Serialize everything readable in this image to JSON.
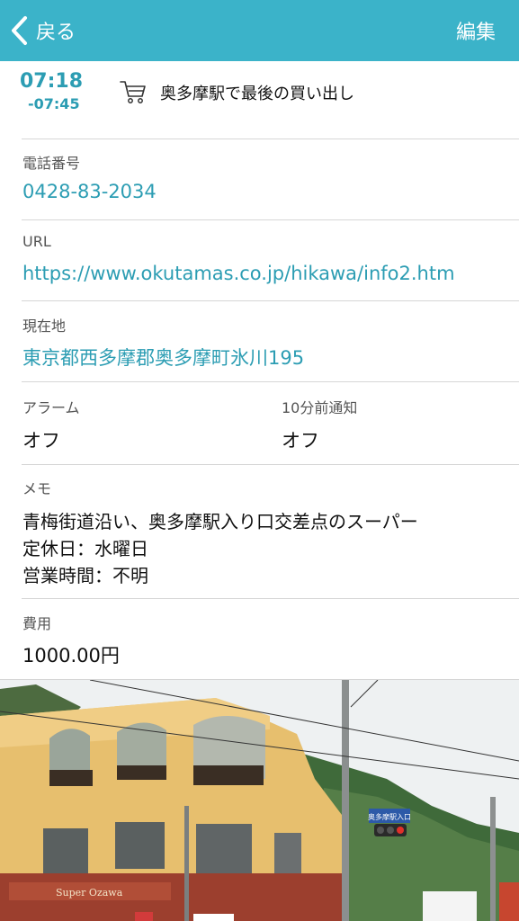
{
  "nav": {
    "back_label": "戻る",
    "edit_label": "編集",
    "bar_color": "#3bb3c9"
  },
  "event": {
    "start_time": "07:18",
    "end_time": "-07:45",
    "icon": "cart-icon",
    "title": "奥多摩駅で最後の買い出し",
    "accent_color": "#2c9db3"
  },
  "phone": {
    "label": "電話番号",
    "value": "0428-83-2034"
  },
  "url": {
    "label": "URL",
    "value": "https://www.okutamas.co.jp/hikawa/info2.htm"
  },
  "location": {
    "label": "現在地",
    "value": "東京都西多摩郡奥多摩町氷川195"
  },
  "alarm": {
    "label": "アラーム",
    "value": "オフ"
  },
  "notify": {
    "label": "10分前通知",
    "value": "オフ"
  },
  "memo": {
    "label": "メモ",
    "lines": [
      "青梅街道沿い、奥多摩駅入り口交差点のスーパー",
      "定休日：水曜日",
      "営業時間：不明"
    ]
  },
  "cost": {
    "label": "費用",
    "value": "1000.00円"
  },
  "photo": {
    "sign_text": "奥多摩駅入口",
    "store_sign": "Super Ozawa"
  }
}
